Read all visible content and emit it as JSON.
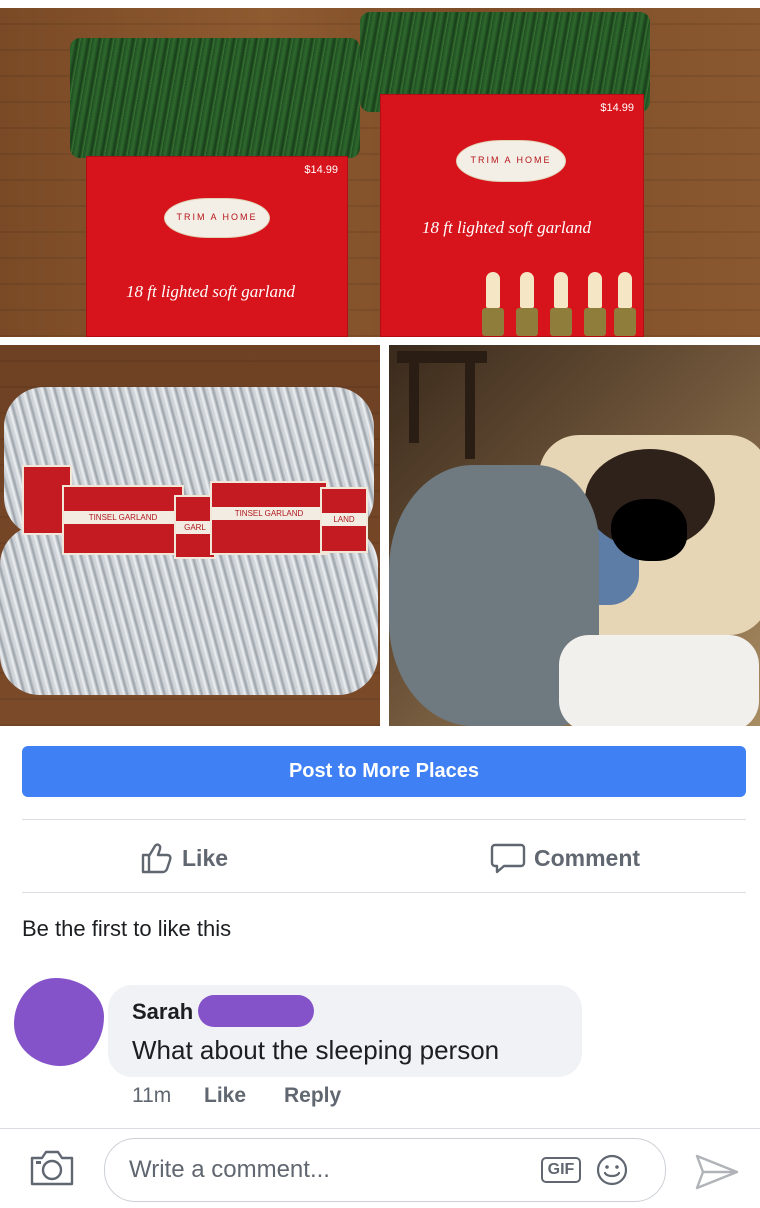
{
  "photo_top": {
    "left_box": {
      "price": "$14.99",
      "brand": "TRIM A HOME",
      "title": "18 ft lighted soft garland"
    },
    "right_box": {
      "price": "$14.99",
      "brand": "TRIM A HOME",
      "title": "18 ft lighted soft garland"
    }
  },
  "photo_tinsel": {
    "tags": [
      "TINSEL GARLAND",
      "GARL",
      "TINSEL GARLAND",
      "LAND"
    ]
  },
  "post_button": {
    "label": "Post to More Places"
  },
  "actions": {
    "like": "Like",
    "comment": "Comment"
  },
  "likes_summary": "Be the first to like this",
  "comment": {
    "author": "Sarah",
    "text": "What about the sleeping person",
    "time": "11m",
    "like": "Like",
    "reply": "Reply"
  },
  "composer": {
    "placeholder": "Write a comment...",
    "gif": "GIF"
  },
  "colors": {
    "accent": "#3f81f5",
    "redaction": "#8553c9",
    "muted_text": "#606770"
  },
  "icons": [
    "thumbs-up-icon",
    "comment-bubble-icon",
    "camera-icon",
    "emoji-icon",
    "send-icon"
  ]
}
